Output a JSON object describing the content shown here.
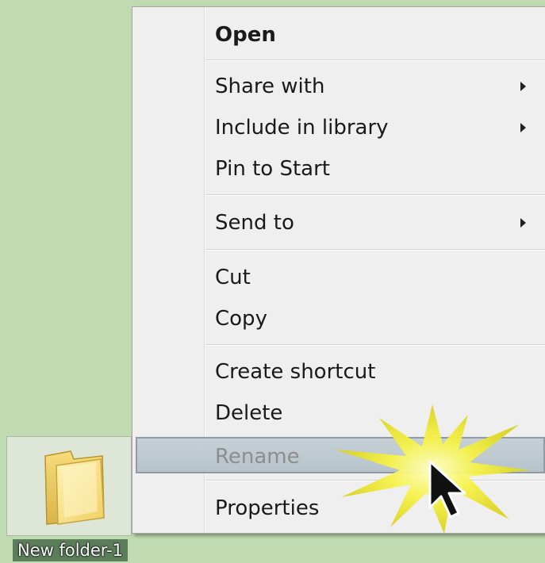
{
  "desktop": {
    "background_color": "#c0dbb2",
    "folder": {
      "icon": "folder-icon",
      "label": "New folder-1"
    }
  },
  "context_menu": {
    "items": [
      {
        "label": "Open",
        "bold": true,
        "submenu": false
      },
      {
        "label": "Share with",
        "submenu": true
      },
      {
        "label": "Include in library",
        "submenu": true
      },
      {
        "label": "Pin to Start",
        "submenu": false
      },
      {
        "label": "Send to",
        "submenu": true
      },
      {
        "label": "Cut",
        "submenu": false
      },
      {
        "label": "Copy",
        "submenu": false
      },
      {
        "label": "Create shortcut",
        "submenu": false
      },
      {
        "label": "Delete",
        "submenu": false
      },
      {
        "label": "Rename",
        "submenu": false,
        "highlighted": true
      },
      {
        "label": "Properties",
        "submenu": false
      }
    ],
    "highlight_color": "#bcc7ce"
  },
  "annotation": {
    "starburst_color": "#f5f23a",
    "cursor_icon": "arrow-cursor-icon"
  }
}
